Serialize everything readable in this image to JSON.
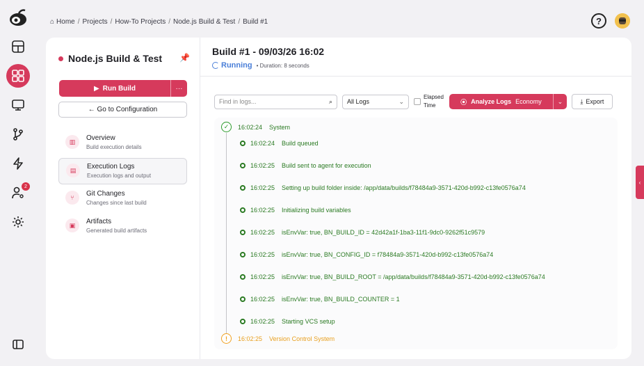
{
  "breadcrumb": [
    "Home",
    "Projects",
    "How-To Projects",
    "Node.js Build & Test",
    "Build #1"
  ],
  "rail": {
    "badge_count": "2"
  },
  "sidebar": {
    "project_name": "Node.js Build & Test",
    "run_label": "Run Build",
    "config_label": "← Go to Configuration",
    "items": [
      {
        "title": "Overview",
        "subtitle": "Build execution details"
      },
      {
        "title": "Execution Logs",
        "subtitle": "Execution logs and output"
      },
      {
        "title": "Git Changes",
        "subtitle": "Changes since last build"
      },
      {
        "title": "Artifacts",
        "subtitle": "Generated build artifacts"
      }
    ]
  },
  "build": {
    "title": "Build #1 - 09/03/26 16:02",
    "status": "Running",
    "duration": "• Duration: 8 seconds"
  },
  "toolbar": {
    "search_placeholder": "Find in logs...",
    "filter_value": "All Logs",
    "elapsed_label_1": "Elapsed",
    "elapsed_label_2": "Time",
    "analyze_label": "Analyze Logs",
    "analyze_mode": "Economy",
    "export_label": "Export"
  },
  "logs": {
    "group_start": {
      "time": "16:02:24",
      "text": "System"
    },
    "entries": [
      {
        "time": "16:02:24",
        "text": "Build queued"
      },
      {
        "time": "16:02:25",
        "text": "Build sent to agent for execution"
      },
      {
        "time": "16:02:25",
        "text": "Setting up build folder inside: /app/data/builds/f78484a9-3571-420d-b992-c13fe0576a74"
      },
      {
        "time": "16:02:25",
        "text": "Initializing build variables"
      },
      {
        "time": "16:02:25",
        "text": "isEnvVar: true,  BN_BUILD_ID = 42d42a1f-1ba3-11f1-9dc0-9262f51c9579"
      },
      {
        "time": "16:02:25",
        "text": "isEnvVar: true,  BN_CONFIG_ID = f78484a9-3571-420d-b992-c13fe0576a74"
      },
      {
        "time": "16:02:25",
        "text": "isEnvVar: true,  BN_BUILD_ROOT = /app/data/builds/f78484a9-3571-420d-b992-c13fe0576a74"
      },
      {
        "time": "16:02:25",
        "text": "isEnvVar: true,  BN_BUILD_COUNTER = 1"
      },
      {
        "time": "16:02:25",
        "text": "Starting VCS setup"
      }
    ],
    "group_next": {
      "time": "16:02:25",
      "text": "Version Control System"
    }
  }
}
